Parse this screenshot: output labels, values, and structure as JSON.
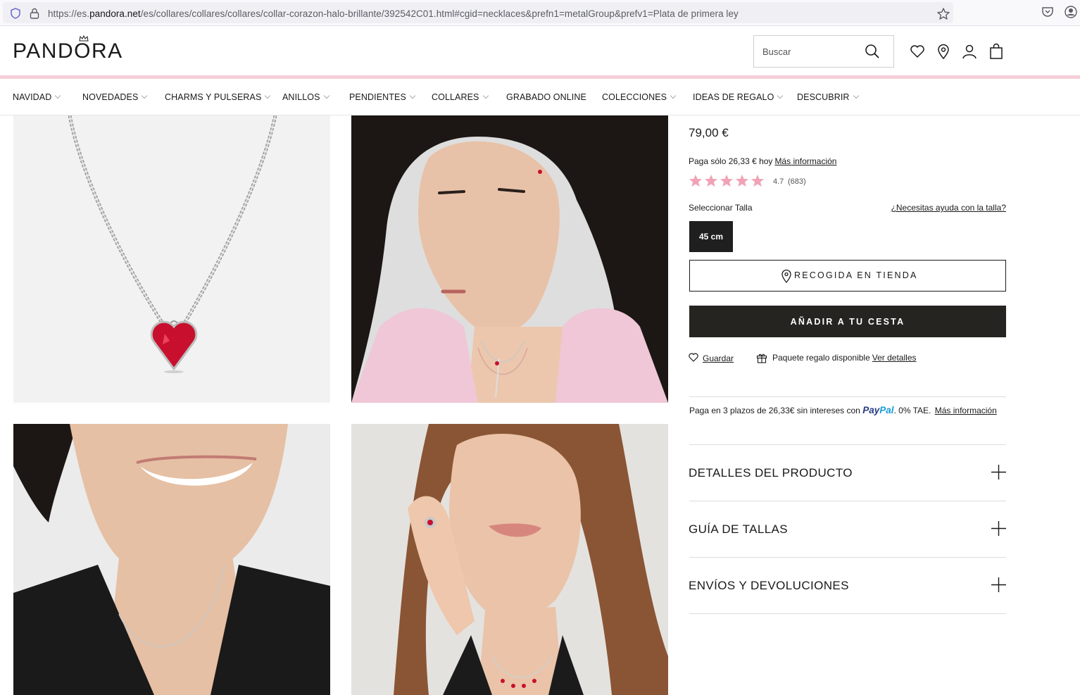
{
  "browser": {
    "url_prefix": "https://es.",
    "url_domain": "pandora.net",
    "url_path": "/es/collares/collares/collares/collar-corazon-halo-brillante/392542C01.html#cgid=necklaces&prefn1=metalGroup&prefv1=Plata de primera ley"
  },
  "header": {
    "logo": "PANDORA",
    "search_placeholder": "Buscar"
  },
  "nav": {
    "items": [
      {
        "label": "NAVIDAD"
      },
      {
        "label": "NOVEDADES"
      },
      {
        "label": "CHARMS Y PULSERAS"
      },
      {
        "label": "ANILLOS"
      },
      {
        "label": "PENDIENTES"
      },
      {
        "label": "COLLARES"
      },
      {
        "label": "GRABADO ONLINE"
      },
      {
        "label": "COLECCIONES"
      },
      {
        "label": "IDEAS DE REGALO"
      },
      {
        "label": "DESCUBRIR"
      }
    ]
  },
  "product": {
    "price": "79,00 €",
    "installment_text": "Paga sólo 26,33 € hoy",
    "installment_link": "Más información",
    "rating": {
      "value": "4.7",
      "count": "(683)",
      "stars": 4.7
    },
    "size_label": "Seleccionar Talla",
    "size_help": "¿Necesitas ayuda con la talla?",
    "size_option": "45 cm",
    "store_button": "RECOGIDA EN TIENDA",
    "cart_button": "AÑADIR A TU CESTA",
    "save_label": "Guardar",
    "gift_text": "Paquete regalo disponible",
    "gift_link": "Ver detalles",
    "paypal_text": "Paga en 3 plazos de 26,33€ sin intereses con",
    "paypal_brand_a": "Pay",
    "paypal_brand_b": "Pal",
    "paypal_tae": ". 0% TAE.",
    "paypal_link": "Más información",
    "accordions": [
      {
        "label": "DETALLES DEL PRODUCTO"
      },
      {
        "label": "GUÍA DE TALLAS"
      },
      {
        "label": "ENVÍOS Y DEVOLUCIONES"
      }
    ]
  },
  "colors": {
    "pink_line": "#f6cfd8",
    "star": "#f0a3b6",
    "cart_button_bg": "#262421",
    "size_button_bg": "#1f1f1f"
  }
}
